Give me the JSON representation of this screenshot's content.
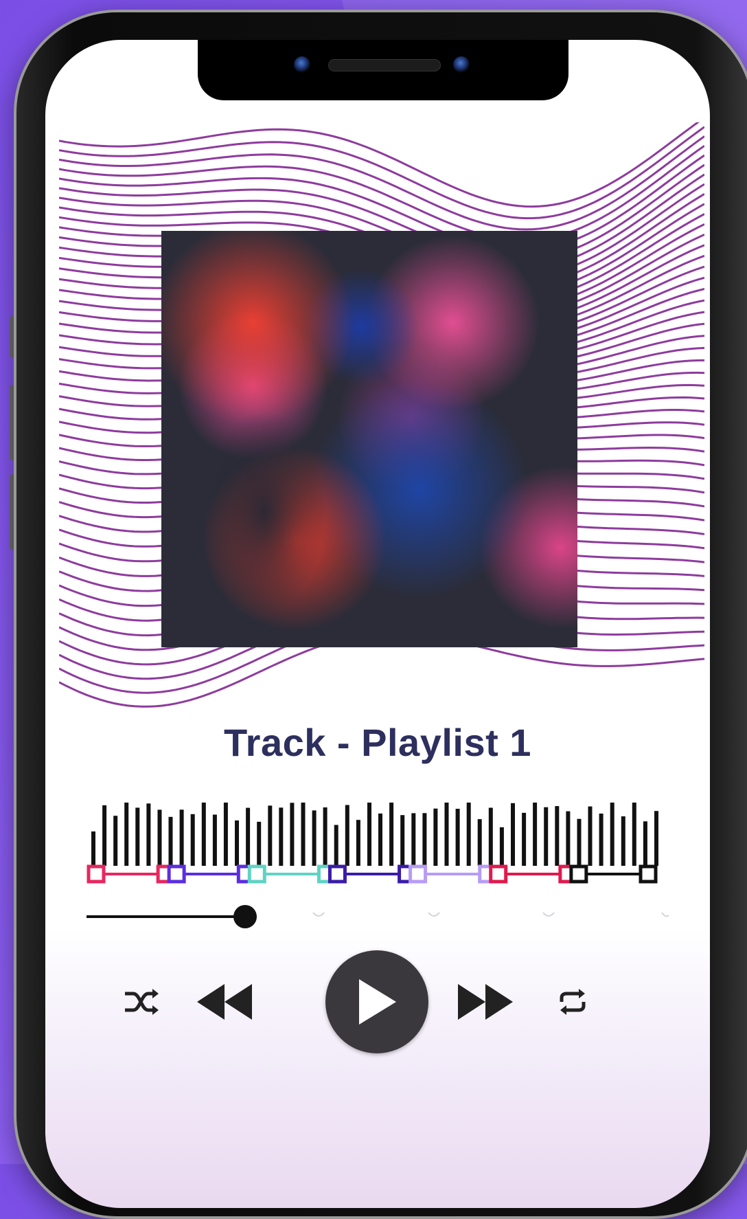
{
  "player": {
    "track_title": "Track - Playlist 1",
    "progress_fraction": 0.3,
    "segment_colors": [
      "#e8275f",
      "#5b2ee0",
      "#5fd3c4",
      "#3a1ca8",
      "#b79cf5",
      "#e01a4e",
      "#111111"
    ]
  },
  "controls": {
    "shuffle_icon": "shuffle-icon",
    "previous_icon": "rewind-icon",
    "play_icon": "play-icon",
    "next_icon": "fast-forward-icon",
    "repeat_icon": "repeat-icon"
  },
  "colors": {
    "background": "#8a5cf0",
    "wave_lines": "#8e3b9e",
    "title": "#2d2f5e",
    "play_button": "#3a373d"
  }
}
